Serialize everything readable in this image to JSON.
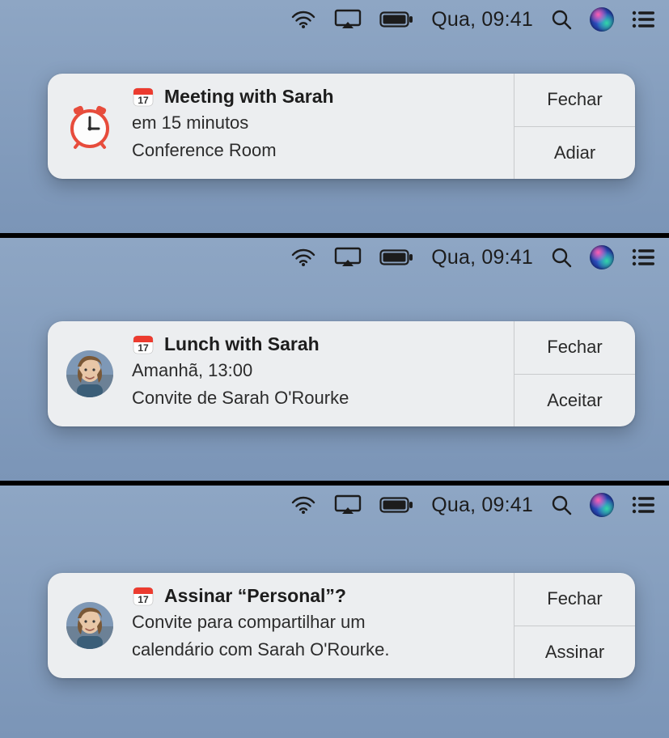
{
  "menubar": {
    "clock": "Qua, 09:41"
  },
  "notifications": [
    {
      "title": "Meeting with Sarah",
      "line1": "em 15 minutos",
      "line2": "Conference Room",
      "action1": "Fechar",
      "action2": "Adiar"
    },
    {
      "title": "Lunch with Sarah",
      "line1": "Amanhã, 13:00",
      "line2": "Convite de Sarah O'Rourke",
      "action1": "Fechar",
      "action2": "Aceitar"
    },
    {
      "title": "Assinar “Personal”?",
      "line1": "Convite para compartilhar um",
      "line2": "calendário com Sarah O'Rourke.",
      "action1": "Fechar",
      "action2": "Assinar"
    }
  ]
}
